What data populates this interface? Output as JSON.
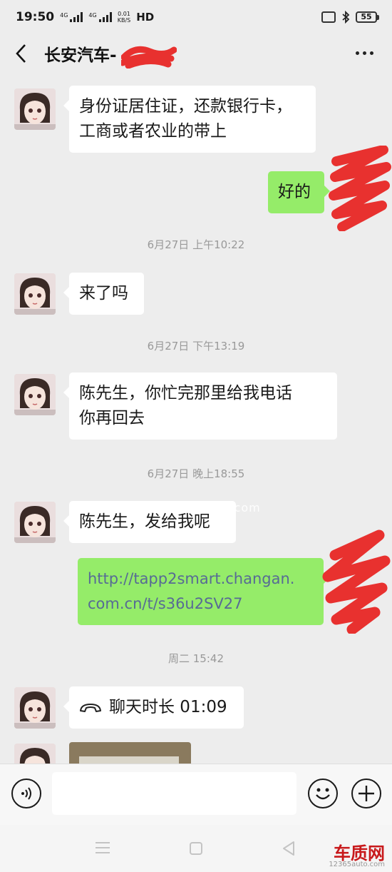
{
  "status_bar": {
    "time": "19:50",
    "signal_label_1": "4G",
    "signal_label_2": "4G",
    "speed_value": "0.01",
    "speed_unit": "KB/S",
    "hd_label": "HD",
    "battery_level": "55",
    "battery_fraction": 0.55,
    "battery_color": "#f2d64b"
  },
  "header": {
    "title": "长安汽车-",
    "back_icon": "chevron-left-icon",
    "more_icon": "ellipsis-icon"
  },
  "messages": [
    {
      "side": "left",
      "lines": [
        "身份证居住证，还款银行卡，",
        "工商或者农业的带上"
      ]
    },
    {
      "side": "right",
      "lines": [
        "好的"
      ]
    },
    {
      "type": "timestamp",
      "text": "6月27日 上午10:22"
    },
    {
      "side": "left",
      "lines": [
        "来了吗"
      ]
    },
    {
      "type": "timestamp",
      "text": "6月27日 下午13:19"
    },
    {
      "side": "left",
      "lines": [
        "陈先生，你忙完那里给我电话",
        "你再回去"
      ]
    },
    {
      "type": "timestamp",
      "text": "6月27日 晚上18:55"
    },
    {
      "side": "left",
      "lines": [
        "陈先生，发给我呢"
      ]
    },
    {
      "side": "right",
      "type": "link",
      "lines": [
        "http://tapp2smart.changan.",
        "com.cn/t/s36u2SV27"
      ]
    },
    {
      "type": "timestamp",
      "text": "周二 15:42"
    },
    {
      "side": "left",
      "type": "call",
      "label": "聊天时长 01:09",
      "icon": "phone-hangup-icon"
    },
    {
      "side": "left",
      "type": "image",
      "icon": "image-thumbnail"
    }
  ],
  "input_bar": {
    "voice_icon": "voice-icon",
    "input_value": "",
    "emoji_icon": "emoji-icon",
    "plus_icon": "plus-icon"
  },
  "system_nav": {
    "menu_icon": "menu-icon",
    "home_icon": "home-icon",
    "back_icon": "triangle-back-icon"
  },
  "watermarks": {
    "middle": "www.12365auto.com",
    "corner_cn": "车质网",
    "corner_url": "12365auto.com"
  },
  "colors": {
    "chat_bg": "#ededed",
    "bubble_left": "#ffffff",
    "bubble_right": "#95ec69",
    "link": "#576b95",
    "timestamp": "#999999",
    "redaction": "#e8312f"
  }
}
